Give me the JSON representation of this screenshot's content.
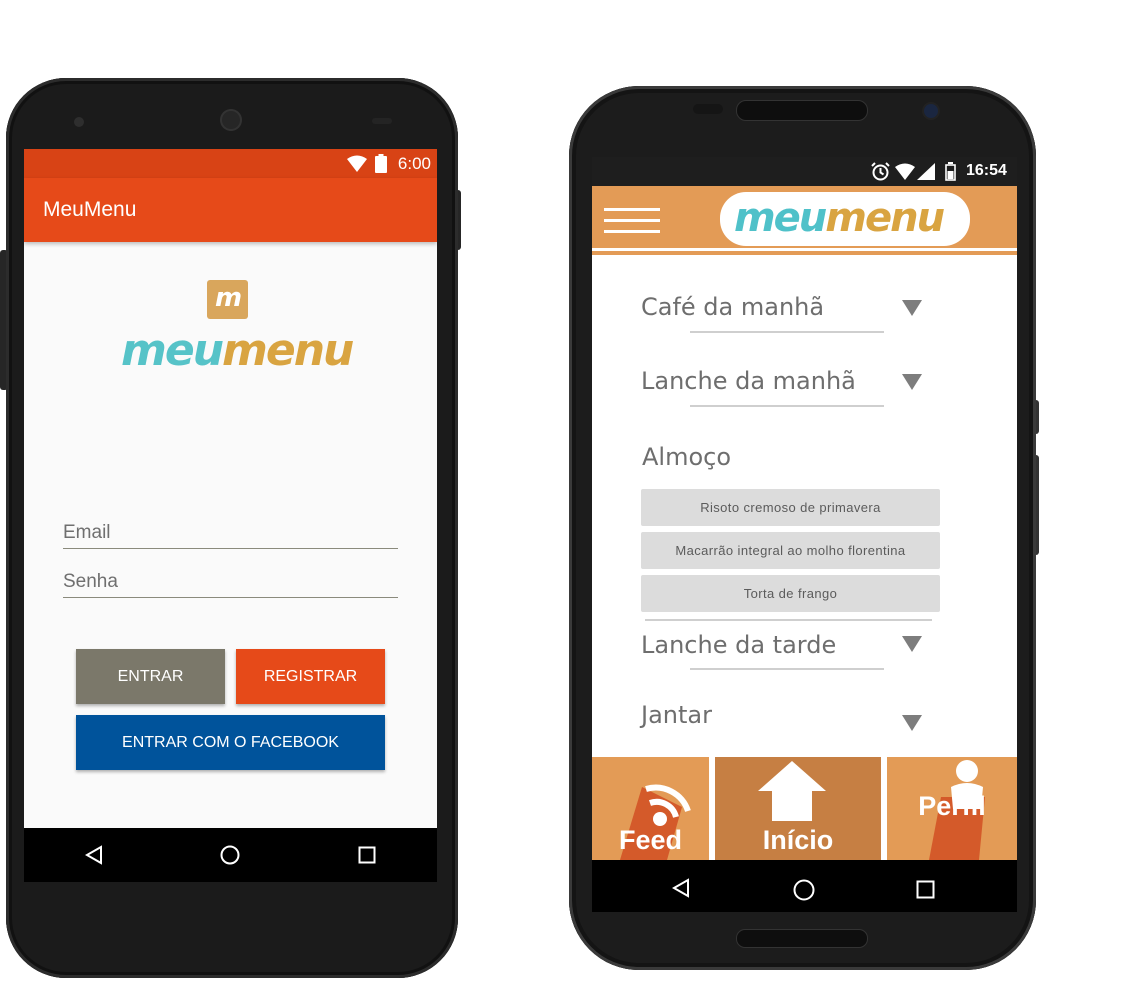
{
  "phone1": {
    "status": {
      "time": "6:00"
    },
    "app_title": "MeuMenu",
    "logo": {
      "part1": "meu",
      "part2": "menu",
      "badge": "m"
    },
    "email_placeholder": "Email",
    "password_placeholder": "Senha",
    "buttons": {
      "enter": "ENTRAR",
      "register": "REGISTRAR",
      "facebook": "ENTRAR COM O FACEBOOK"
    },
    "colors": {
      "appbar": "#e64a19",
      "enter": "#7b786a",
      "register": "#e64a19",
      "facebook": "#00539b"
    }
  },
  "phone2": {
    "status": {
      "time": "16:54"
    },
    "logo": {
      "part1": "meu",
      "part2": "menu"
    },
    "meals": {
      "breakfast": "Café da manhã",
      "morning_snack": "Lanche da manhã",
      "lunch": "Almoço",
      "afternoon_snack": "Lanche da tarde",
      "dinner": "Jantar"
    },
    "lunch_items": [
      "Risoto cremoso de primavera",
      "Macarrão integral ao molho florentina",
      "Torta de frango"
    ],
    "tabs": {
      "feed": "Feed",
      "home": "Início",
      "profile": "Perfil"
    },
    "colors": {
      "header": "#e39b56",
      "active_tab": "#c67f43",
      "logo_teal": "#4fc1c9",
      "logo_gold": "#d9a441"
    }
  }
}
